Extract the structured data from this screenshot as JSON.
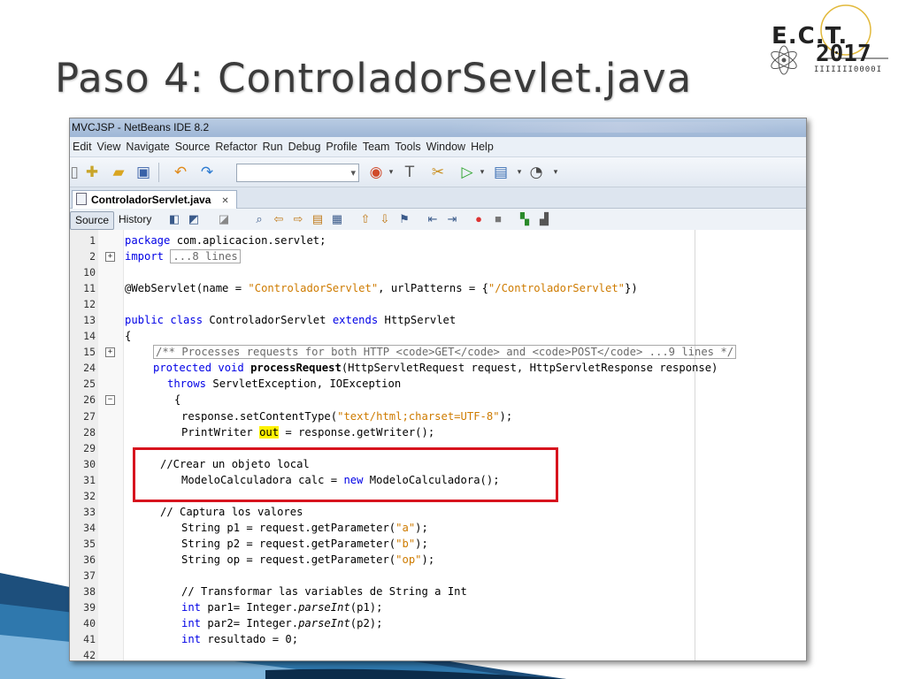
{
  "slide": {
    "title": "Paso 4: ControladorSevlet.java"
  },
  "logo": {
    "name": "E.C.T.",
    "year": "2017",
    "subtitle": "IIIIIII0000I"
  },
  "ide": {
    "window_title": "MVCJSP - NetBeans IDE 8.2",
    "menu": [
      "Edit",
      "View",
      "Navigate",
      "Source",
      "Refactor",
      "Run",
      "Debug",
      "Profile",
      "Team",
      "Tools",
      "Window",
      "Help"
    ],
    "file_tab": {
      "label": "ControladorServlet.java",
      "close": "✕"
    },
    "editor_tabs": {
      "source": "Source",
      "history": "History"
    },
    "code_lines": [
      {
        "num": "1"
      },
      {
        "num": "2"
      },
      {
        "num": "10"
      },
      {
        "num": "11"
      },
      {
        "num": "12"
      },
      {
        "num": "13"
      },
      {
        "num": "14"
      },
      {
        "num": "15"
      },
      {
        "num": "24"
      },
      {
        "num": "25"
      },
      {
        "num": "26"
      },
      {
        "num": "27"
      },
      {
        "num": "28"
      },
      {
        "num": "29"
      },
      {
        "num": "30"
      },
      {
        "num": "31"
      },
      {
        "num": "32"
      },
      {
        "num": "33"
      },
      {
        "num": "34"
      },
      {
        "num": "35"
      },
      {
        "num": "36"
      },
      {
        "num": "37"
      },
      {
        "num": "38"
      },
      {
        "num": "39"
      },
      {
        "num": "40"
      },
      {
        "num": "41"
      },
      {
        "num": "42"
      }
    ],
    "code": {
      "l1_kw": "package",
      "l1_rest": " com.aplicacion.servlet;",
      "l2_kw": "import",
      "l2_fold": "...8 lines",
      "l11_a": "@WebServlet(name = ",
      "l11_s1": "\"ControladorServlet\"",
      "l11_b": ", urlPatterns = {",
      "l11_s2": "\"/ControladorServlet\"",
      "l11_c": "})",
      "l13_kw1": "public class",
      "l13_a": " ControladorServlet ",
      "l13_kw2": "extends",
      "l13_b": " HttpServlet",
      "l14": "{",
      "l15_doc": "/** Processes requests for both HTTP <code>GET</code> and <code>POST</code> ...9 lines */",
      "l24_kw": "protected void",
      "l24_fn": "processRequest",
      "l24_rest": "(HttpServletRequest request, HttpServletResponse response)",
      "l25_kw": "throws",
      "l25_rest": " ServletException, IOException",
      "l26": "{",
      "l27_a": "response.setContentType(",
      "l27_s": "\"text/html;charset=UTF-8\"",
      "l27_b": ");",
      "l28_a": "PrintWriter ",
      "l28_hl": "out",
      "l28_b": " = response.getWriter();",
      "l30_cm": "//Crear un objeto local",
      "l31_a": "ModeloCalculadora calc = ",
      "l31_kw": "new",
      "l31_b": " ModeloCalculadora();",
      "l33_cm": "// Captura los valores",
      "l34_a": "String p1 = request.getParameter(",
      "l34_s": "\"a\"",
      "l34_b": ");",
      "l35_a": "String p2 = request.getParameter(",
      "l35_s": "\"b\"",
      "l35_b": ");",
      "l36_a": "String op = request.getParameter(",
      "l36_s": "\"op\"",
      "l36_b": ");",
      "l38_cm": "// Transformar las variables de String a Int",
      "l39_kw": "int",
      "l39_a": " par1= Integer.",
      "l39_it": "parseInt",
      "l39_b": "(p1);",
      "l40_kw": "int",
      "l40_a": " par2= Integer.",
      "l40_it": "parseInt",
      "l40_b": "(p2);",
      "l41_kw": "int",
      "l41_a": " resultado = 0;"
    }
  },
  "colors": {
    "keyword": "#0000e6",
    "string": "#ce7b00",
    "comment": "#969696",
    "highlight": "#fff200",
    "annotation_box": "#d7141e"
  }
}
